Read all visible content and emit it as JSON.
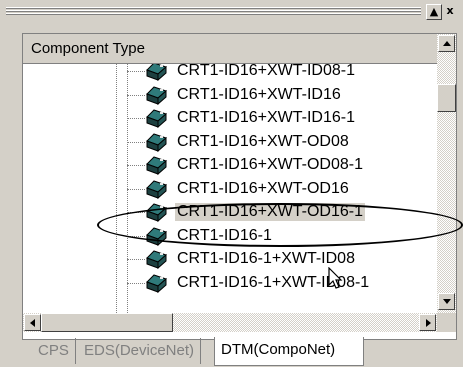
{
  "panel": {
    "column_header": "Component Type",
    "items": [
      {
        "label": "CRT1-ID16+XWT-ID08-1",
        "icon": "device-icon",
        "selected": false
      },
      {
        "label": "CRT1-ID16+XWT-ID16",
        "icon": "device-icon",
        "selected": false
      },
      {
        "label": "CRT1-ID16+XWT-ID16-1",
        "icon": "device-icon",
        "selected": false
      },
      {
        "label": "CRT1-ID16+XWT-OD08",
        "icon": "device-icon",
        "selected": false
      },
      {
        "label": "CRT1-ID16+XWT-OD08-1",
        "icon": "device-icon",
        "selected": false
      },
      {
        "label": "CRT1-ID16+XWT-OD16",
        "icon": "device-icon",
        "selected": false
      },
      {
        "label": "CRT1-ID16+XWT-OD16-1",
        "icon": "device-icon",
        "selected": true
      },
      {
        "label": "CRT1-ID16-1",
        "icon": "device-icon",
        "selected": false
      },
      {
        "label": "CRT1-ID16-1+XWT-ID08",
        "icon": "device-icon",
        "selected": false
      },
      {
        "label": "CRT1-ID16-1+XWT-ID08-1",
        "icon": "device-icon",
        "selected": false
      }
    ]
  },
  "title_buttons": {
    "restore": "▲",
    "close": "x"
  },
  "tabs": [
    {
      "label": "CPS",
      "active": false
    },
    {
      "label": "EDS(DeviceNet)",
      "active": false
    },
    {
      "label": "DTM(CompoNet)",
      "active": true
    }
  ],
  "colors": {
    "face": "#d4d0c8",
    "selection": "#d4d0c8",
    "window": "#ffffff"
  }
}
